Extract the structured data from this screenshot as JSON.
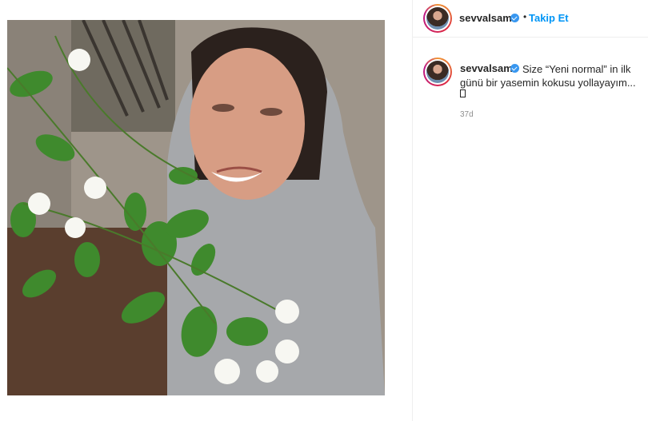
{
  "post": {
    "username": "sevvalsam",
    "follow_label": "Takip Et",
    "separator": "•"
  },
  "caption": {
    "username": "sevvalsam",
    "text": "Size “Yeni normal” in ilk günü bir yasemin kokusu yollayayım...",
    "emoji": "▯",
    "time": "37d"
  },
  "icons": {
    "verified": "verified-badge-icon",
    "avatar": "profile-avatar"
  },
  "colors": {
    "accent": "#0095f6",
    "verified": "#3897f0",
    "muted": "#8e8e8e",
    "text": "#262626"
  }
}
